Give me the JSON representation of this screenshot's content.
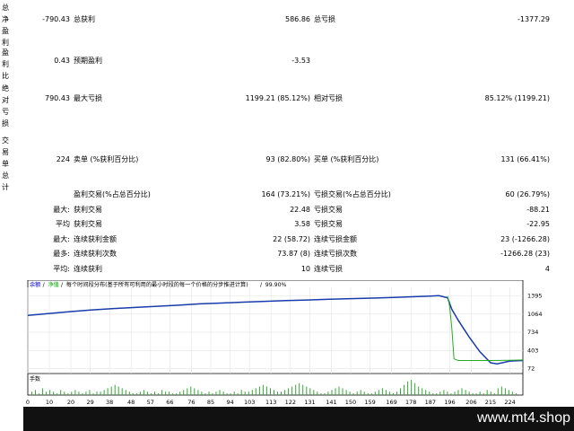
{
  "report": {
    "rows": [
      {
        "label": "总净盈利",
        "v1": "-790.43",
        "k2": "总获利",
        "v2": "586.86",
        "k3": "总亏损",
        "v3": "-1377.29"
      },
      {
        "label": "盈利比",
        "v1": "0.43",
        "k2": "预期盈利",
        "v2": "-3.53",
        "k3": "",
        "v3": ""
      },
      {
        "label": "绝对亏损",
        "v1": "790.43",
        "k2": "最大亏损",
        "v2": "1199.21 (85.12%)",
        "k3": "相对亏损",
        "v3": "85.12% (1199.21)"
      },
      {
        "label": "交易单总计",
        "v1": "224",
        "k2": "卖单 (%获利百分比)",
        "v2": "93 (82.80%)",
        "k3": "买单 (%获利百分比)",
        "v3": "131 (66.41%)"
      }
    ],
    "extra": [
      {
        "pre": "",
        "k2": "盈利交易(%占总百分比)",
        "v2": "164 (73.21%)",
        "k3": "亏损交易(%占总百分比)",
        "v3": "60 (26.79%)"
      },
      {
        "pre": "最大:",
        "k2": "获利交易",
        "v2": "22.48",
        "k3": "亏损交易",
        "v3": "-88.21"
      },
      {
        "pre": "平均",
        "k2": "获利交易",
        "v2": "3.58",
        "k3": "亏损交易",
        "v3": "-22.95"
      },
      {
        "pre": "最大:",
        "k2": "连续获利金额",
        "v2": "22 (58.72)",
        "k3": "连续亏损金额",
        "v3": "23 (-1266.28)"
      },
      {
        "pre": "最多:",
        "k2": "连续获利次数",
        "v2": "73.87 (8)",
        "k3": "连续亏损次数",
        "v3": "-1266.28 (23)"
      },
      {
        "pre": "平均:",
        "k2": "连续获利",
        "v2": "10",
        "k3": "连续亏损",
        "v3": "4"
      }
    ]
  },
  "chart_data": {
    "type": "line",
    "legend_text": [
      "余额",
      "/",
      "净值",
      "/",
      "每个时间段分布(基于所有可利用的最小时段的每一个价格的分步推进计算)",
      "/",
      "99.90%"
    ],
    "legend_colors": [
      "#0000cc",
      "#000000",
      "#00aa00",
      "#000000",
      "#000000",
      "#000000",
      "#000000"
    ],
    "volume_label": "手数",
    "yticks": [
      72,
      403,
      734,
      1064,
      1395
    ],
    "ylim": [
      0,
      1550
    ],
    "xlim": [
      0,
      230
    ],
    "xticks": [
      0,
      10,
      20,
      29,
      38,
      48,
      57,
      66,
      76,
      85,
      94,
      103,
      113,
      122,
      131,
      141,
      150,
      159,
      169,
      178,
      187,
      196,
      206,
      215,
      224
    ],
    "series": [
      {
        "color": "#1a3caa",
        "x": [
          0,
          10,
          20,
          30,
          40,
          50,
          60,
          70,
          80,
          90,
          100,
          110,
          120,
          130,
          140,
          150,
          160,
          170,
          180,
          187,
          191,
          195,
          197,
          200,
          205,
          210,
          215,
          218,
          224,
          230
        ],
        "y": [
          1040,
          1075,
          1110,
          1140,
          1165,
          1185,
          1205,
          1225,
          1250,
          1265,
          1280,
          1295,
          1310,
          1320,
          1335,
          1345,
          1355,
          1365,
          1380,
          1390,
          1398,
          1360,
          1150,
          950,
          650,
          380,
          180,
          160,
          210,
          220
        ]
      },
      {
        "color": "#22aa22",
        "x": [
          195,
          196,
          197,
          198,
          200,
          215,
          224,
          230
        ],
        "y": [
          1390,
          1200,
          800,
          250,
          220,
          220,
          225,
          230
        ]
      }
    ],
    "volume_bars": [
      2,
      3,
      1,
      4,
      2,
      3,
      2,
      1,
      3,
      2,
      1,
      2,
      3,
      2,
      1,
      2,
      3,
      1,
      2,
      2,
      3,
      4,
      5,
      6,
      5,
      4,
      3,
      2,
      1,
      1,
      2,
      3,
      2,
      1,
      2,
      1,
      3,
      2,
      2,
      1,
      1,
      2,
      3,
      4,
      5,
      4,
      3,
      2,
      1,
      2,
      1,
      2,
      3,
      2,
      1,
      1,
      2,
      1,
      3,
      2,
      2,
      3,
      4,
      5,
      6,
      5,
      4,
      3,
      2,
      2,
      3,
      4,
      5,
      6,
      7,
      6,
      5,
      4,
      3,
      2,
      1,
      1,
      2,
      3,
      4,
      5,
      4,
      3,
      2,
      1,
      2,
      3,
      2,
      1,
      1,
      2,
      3,
      4,
      3,
      2,
      1,
      2,
      4,
      6,
      8,
      9,
      7,
      5,
      4,
      3,
      2,
      1,
      1,
      2,
      3,
      2,
      1,
      2,
      3,
      4,
      3,
      2,
      1,
      1,
      2,
      1,
      3,
      2,
      1,
      4,
      5,
      4,
      3,
      2,
      1
    ]
  }
}
